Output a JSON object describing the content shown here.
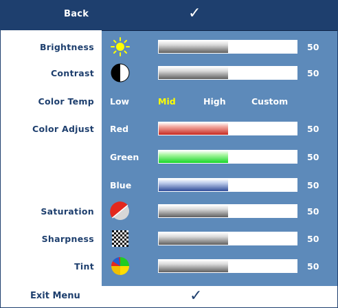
{
  "header": {
    "back_label": "Back",
    "check_glyph": "✓"
  },
  "rows": {
    "brightness": {
      "label": "Brightness",
      "value": "50",
      "level": 0.5,
      "icon": "sun-icon"
    },
    "contrast": {
      "label": "Contrast",
      "value": "50",
      "level": 0.5,
      "icon": "contrast-icon"
    },
    "color_temp": {
      "label": "Color Temp",
      "options": [
        "Low",
        "Mid",
        "High",
        "Custom"
      ],
      "selected": "Mid"
    },
    "color_adjust": {
      "label": "Color Adjust",
      "channels": [
        {
          "name": "Red",
          "value": "50",
          "level": 0.5,
          "color": "#c62b22"
        },
        {
          "name": "Green",
          "value": "50",
          "level": 0.5,
          "color": "#17d628"
        },
        {
          "name": "Blue",
          "value": "50",
          "level": 0.5,
          "color": "#2f4a98"
        }
      ]
    },
    "saturation": {
      "label": "Saturation",
      "value": "50",
      "level": 0.5,
      "icon": "saturation-icon"
    },
    "sharpness": {
      "label": "Sharpness",
      "value": "50",
      "level": 0.5,
      "icon": "sharpness-icon"
    },
    "tint": {
      "label": "Tint",
      "value": "50",
      "level": 0.5,
      "icon": "tint-icon"
    }
  },
  "exit": {
    "label": "Exit Menu",
    "check_glyph": "✓"
  },
  "colors": {
    "panel": "#5d8aba",
    "header": "#1e3f6e",
    "label_text": "#1e3f6e",
    "selected_option": "#ffff00"
  }
}
